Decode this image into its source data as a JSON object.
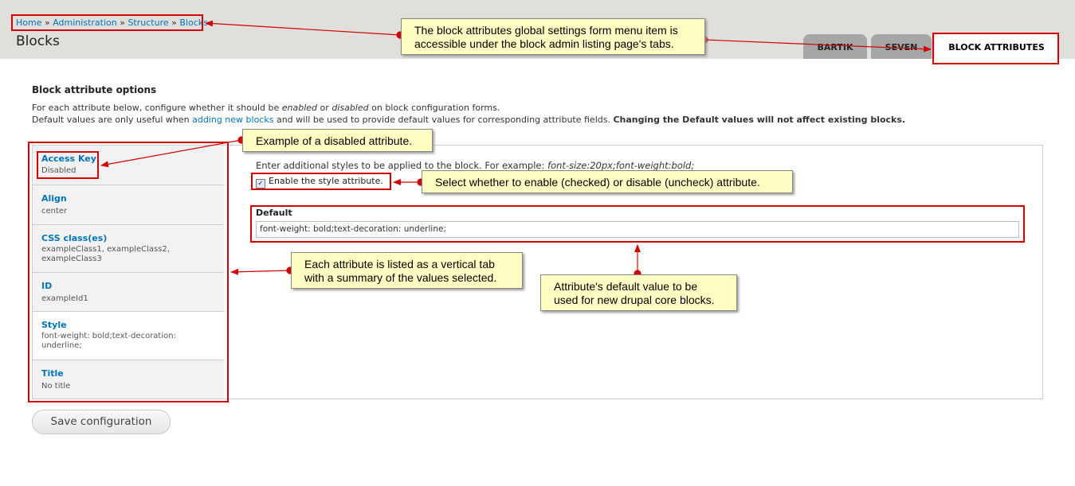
{
  "breadcrumb": {
    "home": "Home",
    "sep1": "»",
    "administration": "Administration",
    "sep2": "»",
    "structure": "Structure",
    "sep3": "»",
    "blocks": "Blocks"
  },
  "page_title": "Blocks",
  "tabs": [
    {
      "label": "BARTIK",
      "active": false
    },
    {
      "label": "SEVEN",
      "active": false
    },
    {
      "label": "BLOCK ATTRIBUTES",
      "active": true
    }
  ],
  "section_title": "Block attribute options",
  "description": {
    "line1_a": "For each attribute below, configure whether it should be",
    "line1_enabled": "enabled",
    "line1_or": "or",
    "line1_disabled": "disabled",
    "line1_b": "on block configuration forms.",
    "line2_a": "Default values are only useful when",
    "line2_link": "adding new blocks",
    "line2_b": "and will be used to provide default values for corresponding attribute fields.",
    "line2_bold": "Changing the Default values will not affect existing blocks."
  },
  "vertical_tabs": [
    {
      "title": "Access Key",
      "summary": "Disabled"
    },
    {
      "title": "Align",
      "summary": "center"
    },
    {
      "title": "CSS class(es)",
      "summary": "exampleClass1, exampleClass2, exampleClass3"
    },
    {
      "title": "ID",
      "summary": "exampleId1"
    },
    {
      "title": "Style",
      "summary": "font-weight: bold;text-decoration: underline;"
    },
    {
      "title": "Title",
      "summary": "No title"
    }
  ],
  "style_panel": {
    "description": "Enter additional styles to be applied to the block. For example:",
    "example": "font-size:20px;font-weight:bold;",
    "checkbox_label": "Enable the style attribute.",
    "checkbox_checked": true,
    "default_label": "Default",
    "default_value": "font-weight: bold;text-decoration: underline;"
  },
  "save_button": "Save configuration",
  "annotations": {
    "tabs_note_1": "The block attributes global settings form menu item is",
    "tabs_note_2": "accessible under the block admin listing page's tabs.",
    "disabled_note": "Example of a disabled attribute.",
    "checkbox_note": "Select whether to enable (checked) or disable (uncheck) attribute.",
    "vtab_note_1": "Each attribute is listed as a vertical tab",
    "vtab_note_2": "with a summary of the values selected.",
    "default_note_1": "Attribute's default value to be",
    "default_note_2": "used for new drupal core blocks."
  },
  "colors": {
    "annotation_red": "#d40000",
    "note_bg": "#ffffc4",
    "link": "#0074bd",
    "header_bg": "#e1dfdc"
  }
}
